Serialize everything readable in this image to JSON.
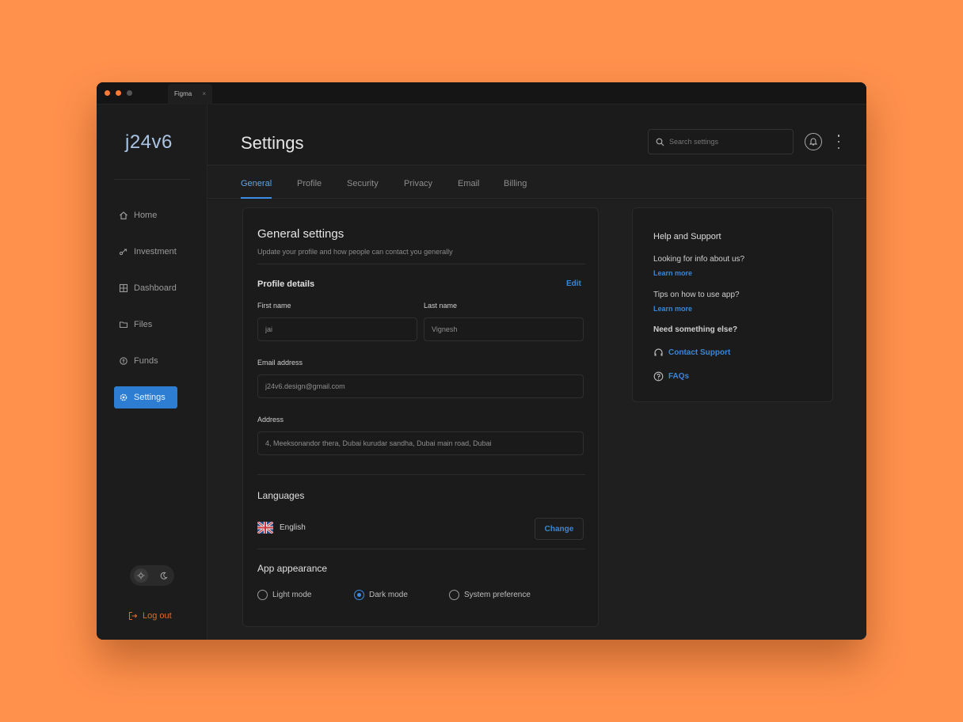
{
  "window": {
    "tab_label": "Figma",
    "tab_close": "×"
  },
  "sidebar": {
    "logo": "j24v6",
    "items": [
      {
        "label": "Home",
        "icon": "home-icon"
      },
      {
        "label": "Investment",
        "icon": "investment-icon"
      },
      {
        "label": "Dashboard",
        "icon": "dashboard-icon"
      },
      {
        "label": "Files",
        "icon": "folder-icon"
      },
      {
        "label": "Funds",
        "icon": "funds-icon"
      },
      {
        "label": "Settings",
        "icon": "gear-icon",
        "active": true
      }
    ],
    "logout_label": "Log out"
  },
  "header": {
    "title": "Settings",
    "search_placeholder": "Search settings"
  },
  "tabs": [
    {
      "label": "General",
      "active": true
    },
    {
      "label": "Profile"
    },
    {
      "label": "Security"
    },
    {
      "label": "Privacy"
    },
    {
      "label": "Email"
    },
    {
      "label": "Billing"
    }
  ],
  "general": {
    "title": "General settings",
    "subtitle": "Update your profile and how people can contact you generally",
    "profile_details_label": "Profile details",
    "edit_label": "Edit",
    "first_name_label": "First name",
    "first_name_value": "jai",
    "last_name_label": "Last name",
    "last_name_value": "Vignesh",
    "email_label": "Email address",
    "email_value": "j24v6.design@gmail.com",
    "address_label": "Address",
    "address_value": "4, Meeksonandor thera, Dubai kurudar sandha, Dubai main road, Dubai",
    "languages_label": "Languages",
    "language_value": "English",
    "change_label": "Change",
    "appearance_label": "App appearance",
    "appearance_options": [
      {
        "label": "Light mode",
        "selected": false
      },
      {
        "label": "Dark mode",
        "selected": true
      },
      {
        "label": "System preference",
        "selected": false
      }
    ]
  },
  "help": {
    "title": "Help and Support",
    "q1": "Looking for info about us?",
    "q1_link": "Learn more",
    "q2": "Tips on how to use app?",
    "q2_link": "Learn more",
    "q3": "Need something else?",
    "contact_label": "Contact Support",
    "faq_label": "FAQs"
  },
  "colors": {
    "background": "#FF914D",
    "accent": "#3B8DE6",
    "logout": "#E06A2C"
  }
}
